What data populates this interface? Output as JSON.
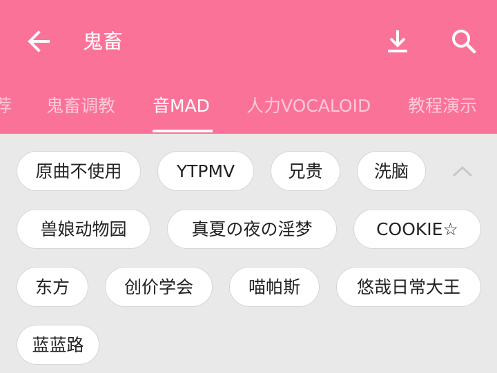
{
  "header": {
    "title": "鬼畜",
    "back_icon": "arrow-left-icon",
    "download_icon": "download-icon",
    "search_icon": "search-icon",
    "bg_color": "#fb7299"
  },
  "tabs": [
    {
      "label": "荐"
    },
    {
      "label": "鬼畜调教"
    },
    {
      "label": "音MAD",
      "active": true
    },
    {
      "label": "人力VOCALOID"
    },
    {
      "label": "教程演示"
    }
  ],
  "tags": [
    {
      "label": "原曲不使用"
    },
    {
      "label": "YTPMV"
    },
    {
      "label": "兄贵"
    },
    {
      "label": "洗脑"
    },
    {
      "label": "兽娘动物园"
    },
    {
      "label": "真夏の夜の淫梦"
    },
    {
      "label": "COOKIE☆"
    },
    {
      "label": "东方"
    },
    {
      "label": "创价学会"
    },
    {
      "label": "喵帕斯"
    },
    {
      "label": "悠哉日常大王"
    },
    {
      "label": "蓝蓝路"
    }
  ],
  "collapse_icon": "chevron-up-icon"
}
